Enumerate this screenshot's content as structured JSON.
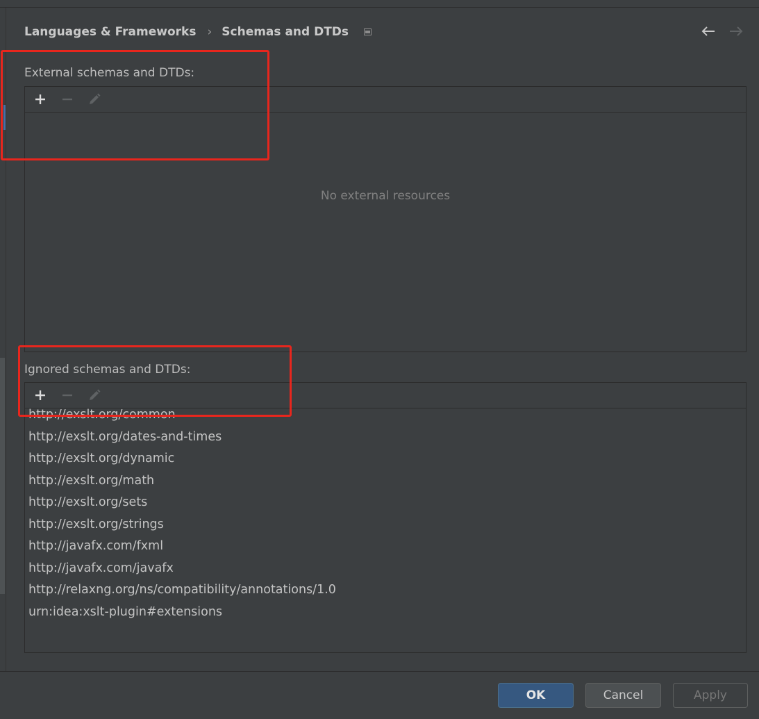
{
  "header": {
    "breadcrumb_parent": "Languages & Frameworks",
    "breadcrumb_sep": "›",
    "breadcrumb_current": "Schemas and DTDs"
  },
  "external": {
    "label": "External schemas and DTDs:",
    "empty_text": "No external resources"
  },
  "ignored": {
    "label": "Ignored schemas and DTDs:",
    "items": [
      "http://exslt.org/common",
      "http://exslt.org/dates-and-times",
      "http://exslt.org/dynamic",
      "http://exslt.org/math",
      "http://exslt.org/sets",
      "http://exslt.org/strings",
      "http://javafx.com/fxml",
      "http://javafx.com/javafx",
      "http://relaxng.org/ns/compatibility/annotations/1.0",
      "urn:idea:xslt-plugin#extensions"
    ]
  },
  "buttons": {
    "ok": "OK",
    "cancel": "Cancel",
    "apply": "Apply"
  },
  "icons": {
    "add": "plus-icon",
    "remove": "minus-icon",
    "edit": "pencil-icon",
    "back": "arrow-left-icon",
    "forward": "arrow-right-icon"
  },
  "colors": {
    "background": "#3c3f41",
    "ok_button": "#365880",
    "annotation_red": "#e8261d"
  }
}
